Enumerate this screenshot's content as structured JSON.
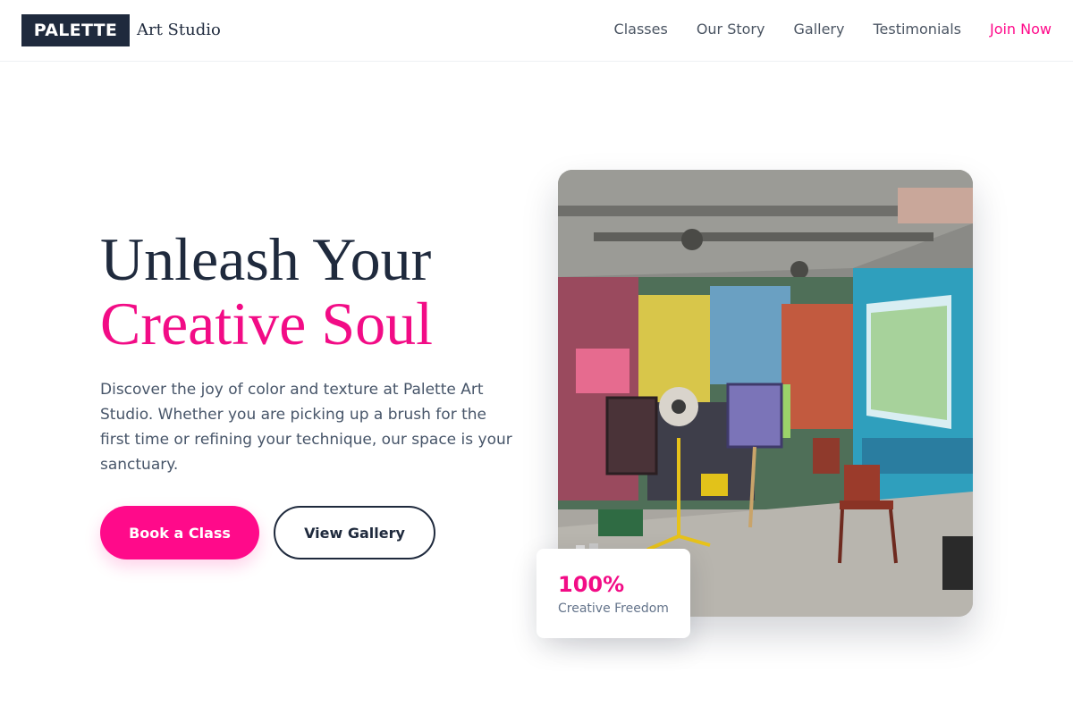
{
  "brand": {
    "logo_text": "PALETTE",
    "subtitle": "Art Studio"
  },
  "nav": {
    "items": [
      {
        "label": "Classes"
      },
      {
        "label": "Our Story"
      },
      {
        "label": "Gallery"
      },
      {
        "label": "Testimonials"
      }
    ],
    "cta_label": "Join Now"
  },
  "hero": {
    "title_line1": "Unleash Your",
    "title_line2": "Creative Soul",
    "description": "Discover the joy of color and texture at Palette Art Studio. Whether you are picking up a brush for the first time or refining your technique, our space is your sanctuary.",
    "primary_button": "Book a Class",
    "secondary_button": "View Gallery",
    "image_subject": "graffiti-covered art studio with easels and chairs"
  },
  "stat": {
    "value": "100%",
    "label": "Creative Freedom"
  },
  "colors": {
    "brand_dark": "#1f2a3d",
    "accent_pink": "#ff0a8a",
    "body_text": "#475569"
  }
}
